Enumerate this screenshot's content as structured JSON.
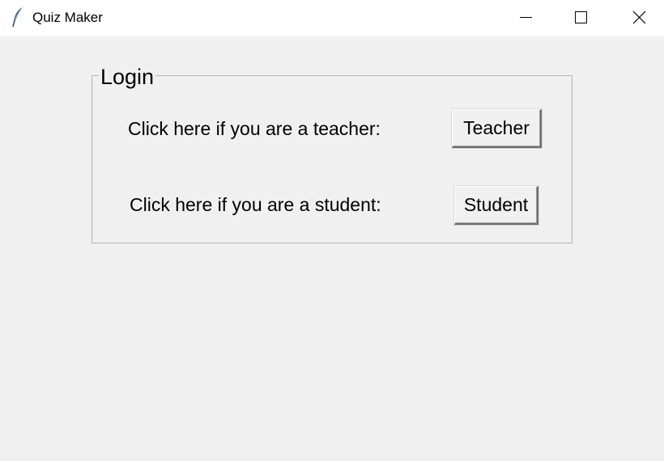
{
  "window": {
    "title": "Quiz Maker",
    "app_icon": "feather-icon",
    "controls": [
      "minimize-icon",
      "maximize-icon",
      "close-icon"
    ]
  },
  "login": {
    "legend": "Login",
    "teacher_prompt": "Click here if you are a teacher:",
    "teacher_button": "Teacher",
    "student_prompt": "Click here if you are a student:",
    "student_button": "Student"
  },
  "colors": {
    "background": "#f0f0f0",
    "titlebar": "#ffffff",
    "groupbox_border": "#b5b5b5"
  }
}
